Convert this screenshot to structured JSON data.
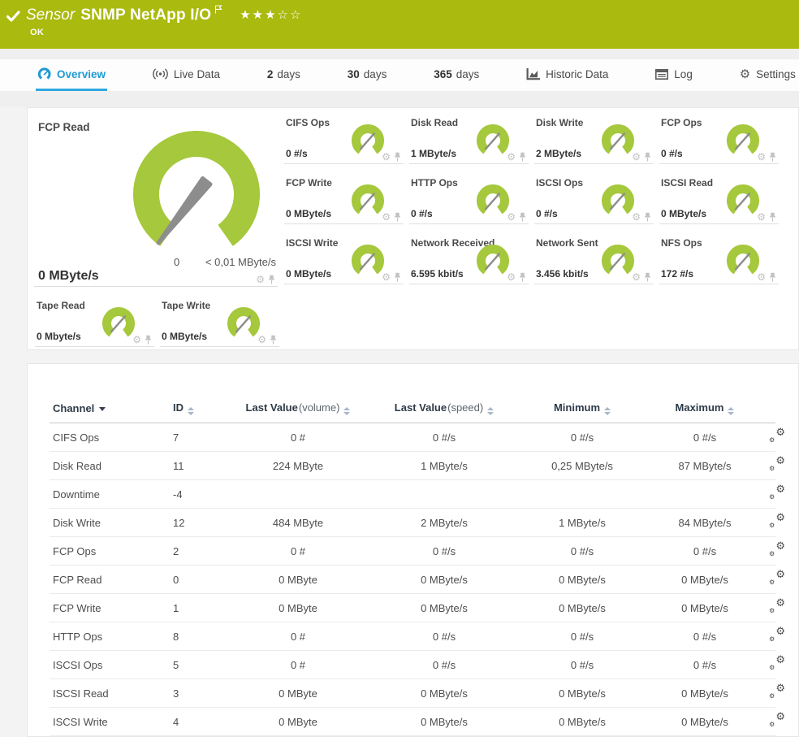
{
  "colors": {
    "header_green": "#aaba0e",
    "gauge_green": "#a5c83c",
    "active_tab_blue": "#1d9ad2"
  },
  "header": {
    "type_label": "Sensor",
    "title": "SNMP NetApp I/O",
    "status": "OK",
    "rating": {
      "filled": 3,
      "total": 5
    }
  },
  "tabs": [
    {
      "label": "Overview",
      "icon": "gauge-icon",
      "active": true
    },
    {
      "label": "Live Data",
      "icon": "live-data-icon"
    },
    {
      "num": "2",
      "label": "days"
    },
    {
      "num": "30",
      "label": "days"
    },
    {
      "num": "365",
      "label": "days"
    },
    {
      "label": "Historic Data",
      "icon": "area-chart-icon"
    },
    {
      "label": "Log",
      "icon": "log-icon"
    },
    {
      "label": "Settings",
      "icon": "gear-icon"
    }
  ],
  "main_gauge": {
    "title": "FCP Read",
    "value": "0 MByte/s",
    "scale_start": "0",
    "scale_end": "< 0,01 MByte/s"
  },
  "mini_gauges": [
    {
      "title": "CIFS Ops",
      "value": "0 #/s"
    },
    {
      "title": "Disk Read",
      "value": "1 MByte/s"
    },
    {
      "title": "Disk Write",
      "value": "2 MByte/s"
    },
    {
      "title": "FCP Ops",
      "value": "0 #/s"
    },
    {
      "title": "FCP Write",
      "value": "0 MByte/s"
    },
    {
      "title": "HTTP Ops",
      "value": "0 #/s"
    },
    {
      "title": "ISCSI Ops",
      "value": "0 #/s"
    },
    {
      "title": "ISCSI Read",
      "value": "0 MByte/s"
    },
    {
      "title": "ISCSI Write",
      "value": "0 MByte/s"
    },
    {
      "title": "Network Received",
      "value": "6.595 kbit/s"
    },
    {
      "title": "Network Sent",
      "value": "3.456 kbit/s"
    },
    {
      "title": "NFS Ops",
      "value": "172 #/s"
    }
  ],
  "tape_gauges": [
    {
      "title": "Tape Read",
      "value": "0 Mbyte/s"
    },
    {
      "title": "Tape Write",
      "value": "0 MByte/s"
    }
  ],
  "table": {
    "columns": [
      {
        "label": "Channel",
        "sorted": true
      },
      {
        "label": "ID"
      },
      {
        "label": "Last Value",
        "sub": "(volume)"
      },
      {
        "label": "Last Value",
        "sub": "(speed)"
      },
      {
        "label": "Minimum"
      },
      {
        "label": "Maximum"
      }
    ],
    "rows": [
      [
        "CIFS Ops",
        "7",
        "0 #",
        "0 #/s",
        "0 #/s",
        "0 #/s"
      ],
      [
        "Disk Read",
        "11",
        "224 MByte",
        "1 MByte/s",
        "0,25 MByte/s",
        "87 MByte/s"
      ],
      [
        "Downtime",
        "-4",
        "",
        "",
        "",
        ""
      ],
      [
        "Disk Write",
        "12",
        "484 MByte",
        "2 MByte/s",
        "1 MByte/s",
        "84 MByte/s"
      ],
      [
        "FCP Ops",
        "2",
        "0 #",
        "0 #/s",
        "0 #/s",
        "0 #/s"
      ],
      [
        "FCP Read",
        "0",
        "0 MByte",
        "0 MByte/s",
        "0 MByte/s",
        "0 MByte/s"
      ],
      [
        "FCP Write",
        "1",
        "0 MByte",
        "0 MByte/s",
        "0 MByte/s",
        "0 MByte/s"
      ],
      [
        "HTTP Ops",
        "8",
        "0 #",
        "0 #/s",
        "0 #/s",
        "0 #/s"
      ],
      [
        "ISCSI Ops",
        "5",
        "0 #",
        "0 #/s",
        "0 #/s",
        "0 #/s"
      ],
      [
        "ISCSI Read",
        "3",
        "0 MByte",
        "0 MByte/s",
        "0 MByte/s",
        "0 MByte/s"
      ],
      [
        "ISCSI Write",
        "4",
        "0 MByte",
        "0 MByte/s",
        "0 MByte/s",
        "0 MByte/s"
      ]
    ]
  }
}
